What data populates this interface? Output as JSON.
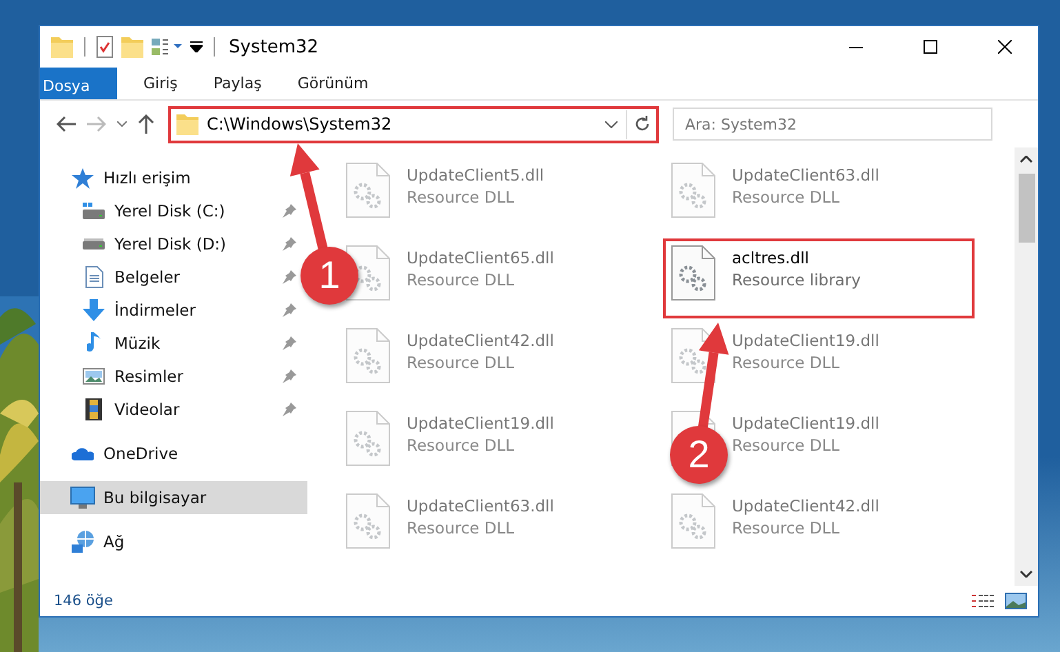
{
  "window": {
    "title": "System32"
  },
  "ribbon_tabs": [
    {
      "label": "Dosya",
      "kind": "file"
    },
    {
      "label": "Giriş",
      "kind": "tab"
    },
    {
      "label": "Paylaş",
      "kind": "tab"
    },
    {
      "label": "Görünüm",
      "kind": "tab"
    }
  ],
  "address": {
    "path": "C:\\Windows\\System32",
    "highlighted": true
  },
  "search": {
    "placeholder": "Ara: System32"
  },
  "navigation": [
    {
      "label": "Hızlı erişim",
      "selected": false,
      "children": [
        {
          "label": "Yerel Disk (C:)",
          "selected": false,
          "pinned": true
        },
        {
          "label": "Yerel Disk (D:)",
          "selected": false,
          "pinned": true
        },
        {
          "label": "Belgeler",
          "selected": false,
          "pinned": true
        },
        {
          "label": "İndirmeler",
          "selected": false,
          "pinned": true
        },
        {
          "label": "Müzik",
          "selected": false,
          "pinned": true
        },
        {
          "label": "Resimler",
          "selected": false,
          "pinned": true
        },
        {
          "label": "Videolar",
          "selected": false,
          "pinned": true
        }
      ]
    },
    {
      "label": "OneDrive",
      "selected": false
    },
    {
      "label": "Bu bilgisayar",
      "selected": true
    },
    {
      "label": "Ağ",
      "selected": false
    }
  ],
  "files": [
    {
      "name": "UpdateClient5.dll",
      "description": "Resource DLL",
      "blurred": true,
      "highlighted": false
    },
    {
      "name": "UpdateClient63.dll",
      "description": "Resource DLL",
      "blurred": true,
      "highlighted": false
    },
    {
      "name": "UpdateClient65.dll",
      "description": "Resource DLL",
      "blurred": true,
      "highlighted": false
    },
    {
      "name": "acltres.dll",
      "description": "Resource library",
      "blurred": false,
      "highlighted": true
    },
    {
      "name": "UpdateClient42.dll",
      "description": "Resource DLL",
      "blurred": true,
      "highlighted": false
    },
    {
      "name": "UpdateClient19.dll",
      "description": "Resource DLL",
      "blurred": true,
      "highlighted": false
    },
    {
      "name": "UpdateClient19.dll",
      "description": "Resource DLL",
      "blurred": true,
      "highlighted": false
    },
    {
      "name": "UpdateClient19.dll",
      "description": "Resource DLL",
      "blurred": true,
      "highlighted": false
    },
    {
      "name": "UpdateClient63.dll",
      "description": "Resource DLL",
      "blurred": true,
      "highlighted": false
    },
    {
      "name": "UpdateClient42.dll",
      "description": "Resource DLL",
      "blurred": true,
      "highlighted": false
    }
  ],
  "status_bar": {
    "item_count": "146 öğe"
  },
  "annotations": [
    {
      "number": "1"
    },
    {
      "number": "2"
    }
  ]
}
